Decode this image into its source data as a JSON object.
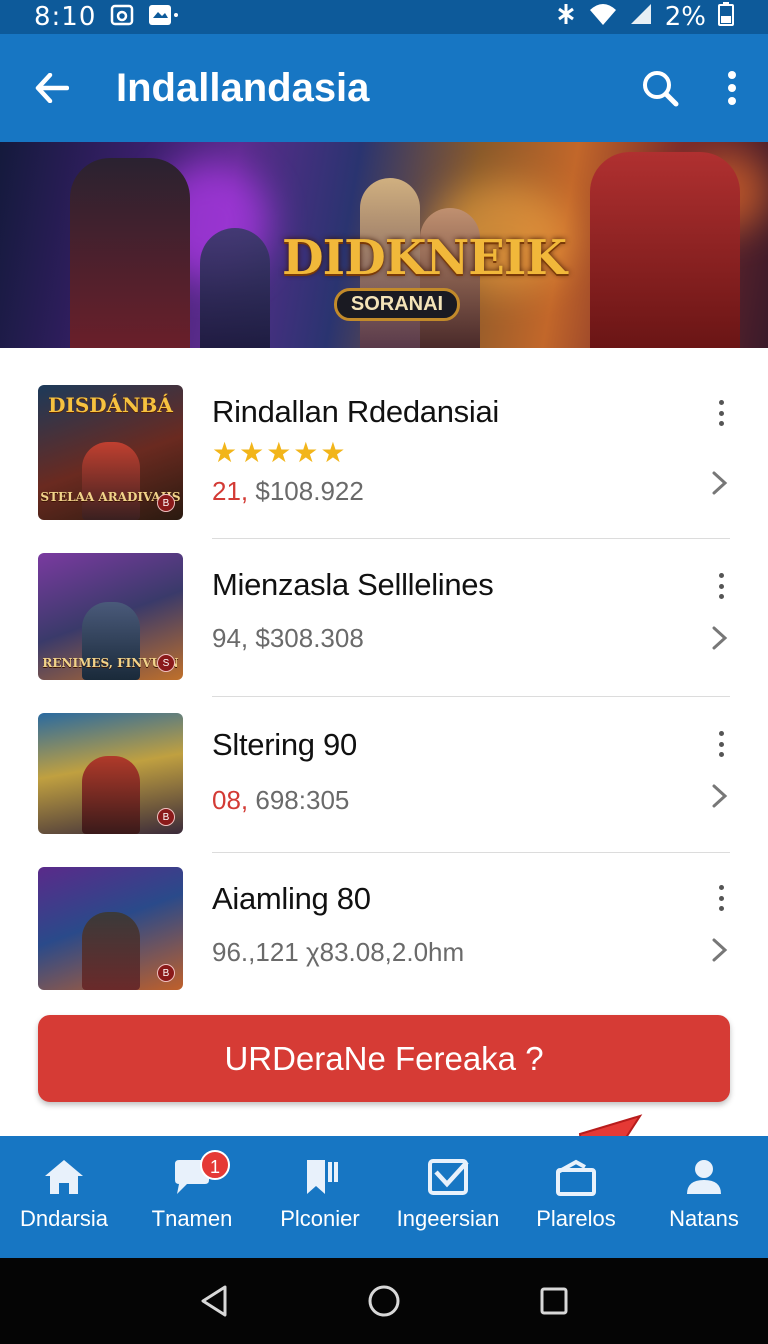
{
  "status_bar": {
    "time": "8:10",
    "battery": "2%",
    "left_icons": [
      "photo-icon",
      "notification-icon"
    ],
    "right_icons": [
      "bluetooth-icon",
      "wifi-icon",
      "signal-icon",
      "battery-icon"
    ]
  },
  "app_bar": {
    "title": "Indallandasia",
    "back_icon": "arrow-left-icon",
    "actions": [
      "search-icon",
      "more-vertical-icon"
    ]
  },
  "banner": {
    "logo": "DIDKNEIK",
    "sublogo": "SORANAI"
  },
  "list": {
    "items": [
      {
        "thumb_title": "DISDÁNBÁ",
        "thumb_sub": "STELAA ARADIVAIIS",
        "thumb_badge": "B",
        "title": "Rindallan Rdedansiai",
        "rating": 5,
        "stars": "★★★★★",
        "sub_red": "21,",
        "sub_rest": " $108.922"
      },
      {
        "thumb_title": "",
        "thumb_sub": "RENIMES, FINVUIN",
        "thumb_badge": "S",
        "title": "Mienzasla Selllelines",
        "sub_red": "",
        "sub_rest": "94, $308.308"
      },
      {
        "thumb_title": "",
        "thumb_sub": "",
        "thumb_badge": "B",
        "title": "Sltering 90",
        "sub_red": "08,",
        "sub_rest": " 698:305"
      },
      {
        "thumb_title": "",
        "thumb_sub": "",
        "thumb_badge": "B",
        "title": "Aiamling 80",
        "sub_red": "",
        "sub_rest": "96.,121  χ83.08,2.0hm"
      }
    ]
  },
  "cta": {
    "label": "URDeraNe Fereaka ?"
  },
  "bottom_nav": {
    "items": [
      {
        "label": "Dndarsia",
        "icon": "home-icon"
      },
      {
        "label": "Tnamen",
        "icon": "chat-icon",
        "badge": "1"
      },
      {
        "label": "Plconier",
        "icon": "bookmark-icon"
      },
      {
        "label": "Ingeersian",
        "icon": "checkbox-icon"
      },
      {
        "label": "Plarelos",
        "icon": "inbox-icon"
      },
      {
        "label": "Natans",
        "icon": "person-icon"
      }
    ]
  },
  "system_nav": [
    "back-triangle-icon",
    "home-circle-icon",
    "recents-square-icon"
  ],
  "colors": {
    "app_bar": "#1776c3",
    "status_bar": "#0d5a9a",
    "cta": "#d63b35",
    "star": "#f2b51a",
    "price_red": "#d33b35"
  }
}
